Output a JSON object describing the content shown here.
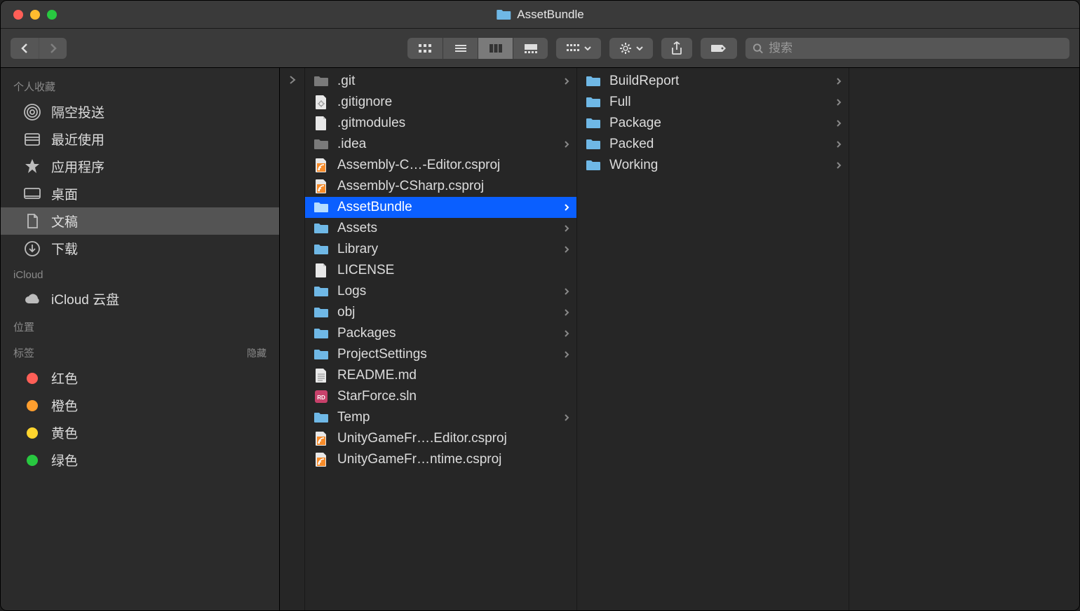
{
  "title": "AssetBundle",
  "search": {
    "placeholder": "搜索"
  },
  "sidebar": {
    "sections": [
      {
        "header": "个人收藏",
        "items": [
          {
            "name": "airdrop",
            "label": "隔空投送",
            "icon": "airdrop"
          },
          {
            "name": "recents",
            "label": "最近使用",
            "icon": "recents"
          },
          {
            "name": "applications",
            "label": "应用程序",
            "icon": "applications"
          },
          {
            "name": "desktop",
            "label": "桌面",
            "icon": "desktop"
          },
          {
            "name": "documents",
            "label": "文稿",
            "icon": "documents",
            "selected": true
          },
          {
            "name": "downloads",
            "label": "下载",
            "icon": "downloads"
          }
        ]
      },
      {
        "header": "iCloud",
        "items": [
          {
            "name": "icloud-drive",
            "label": "iCloud 云盘",
            "icon": "cloud"
          }
        ]
      },
      {
        "header": "位置",
        "items": []
      },
      {
        "header": "标签",
        "hideLabel": "隐藏",
        "items": [
          {
            "name": "tag-red",
            "label": "红色",
            "icon": "tag",
            "color": "#ff5f57"
          },
          {
            "name": "tag-orange",
            "label": "橙色",
            "icon": "tag",
            "color": "#fe9e2e"
          },
          {
            "name": "tag-yellow",
            "label": "黄色",
            "icon": "tag",
            "color": "#ffd52e"
          },
          {
            "name": "tag-green",
            "label": "绿色",
            "icon": "tag",
            "color": "#28c840"
          }
        ]
      }
    ]
  },
  "columns": [
    {
      "items": [
        {
          "label": ".git",
          "type": "folder-gray",
          "hasChildren": true
        },
        {
          "label": ".gitignore",
          "type": "gear-file"
        },
        {
          "label": ".gitmodules",
          "type": "blank-file"
        },
        {
          "label": ".idea",
          "type": "folder-gray",
          "hasChildren": true
        },
        {
          "label": "Assembly-C…-Editor.csproj",
          "type": "rss-file"
        },
        {
          "label": "Assembly-CSharp.csproj",
          "type": "rss-file"
        },
        {
          "label": "AssetBundle",
          "type": "folder",
          "hasChildren": true,
          "selected": true
        },
        {
          "label": "Assets",
          "type": "folder",
          "hasChildren": true
        },
        {
          "label": "Library",
          "type": "folder",
          "hasChildren": true
        },
        {
          "label": "LICENSE",
          "type": "blank-file"
        },
        {
          "label": "Logs",
          "type": "folder",
          "hasChildren": true
        },
        {
          "label": "obj",
          "type": "folder",
          "hasChildren": true
        },
        {
          "label": "Packages",
          "type": "folder",
          "hasChildren": true
        },
        {
          "label": "ProjectSettings",
          "type": "folder",
          "hasChildren": true
        },
        {
          "label": "README.md",
          "type": "text-file"
        },
        {
          "label": "StarForce.sln",
          "type": "sln-file"
        },
        {
          "label": "Temp",
          "type": "folder",
          "hasChildren": true
        },
        {
          "label": "UnityGameFr….Editor.csproj",
          "type": "rss-file"
        },
        {
          "label": "UnityGameFr…ntime.csproj",
          "type": "rss-file"
        }
      ]
    },
    {
      "items": [
        {
          "label": "BuildReport",
          "type": "folder",
          "hasChildren": true
        },
        {
          "label": "Full",
          "type": "folder",
          "hasChildren": true
        },
        {
          "label": "Package",
          "type": "folder",
          "hasChildren": true
        },
        {
          "label": "Packed",
          "type": "folder",
          "hasChildren": true
        },
        {
          "label": "Working",
          "type": "folder",
          "hasChildren": true
        }
      ]
    }
  ]
}
